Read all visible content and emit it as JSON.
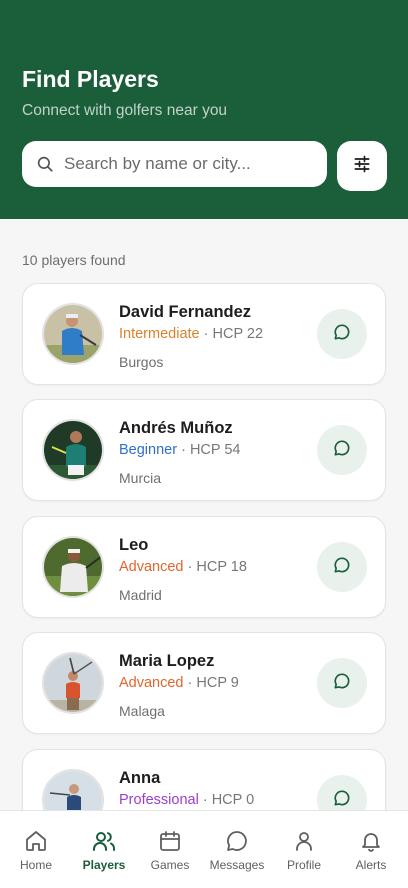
{
  "header": {
    "title": "Find Players",
    "subtitle": "Connect with golfers near you",
    "search_placeholder": "Search by name or city..."
  },
  "results": {
    "count_label": "10 players found"
  },
  "players": [
    {
      "name": "David Fernandez",
      "level": "Intermediate",
      "level_color": "#d9822b",
      "handicap": "HCP 22",
      "city": "Burgos"
    },
    {
      "name": "Andrés Muñoz",
      "level": "Beginner",
      "level_color": "#2f6fcf",
      "handicap": "HCP 54",
      "city": "Murcia"
    },
    {
      "name": "Leo",
      "level": "Advanced",
      "level_color": "#e0662a",
      "handicap": "HCP 18",
      "city": "Madrid"
    },
    {
      "name": "Maria Lopez",
      "level": "Advanced",
      "level_color": "#e0662a",
      "handicap": "HCP 9",
      "city": "Malaga"
    },
    {
      "name": "Anna",
      "level": "Professional",
      "level_color": "#9b3fd0",
      "handicap": "HCP 0",
      "city": ""
    }
  ],
  "separator": " · ",
  "tabs": [
    {
      "label": "Home",
      "icon": "home-icon"
    },
    {
      "label": "Players",
      "icon": "players-icon",
      "active": true
    },
    {
      "label": "Games",
      "icon": "calendar-icon"
    },
    {
      "label": "Messages",
      "icon": "message-icon"
    },
    {
      "label": "Profile",
      "icon": "profile-icon"
    },
    {
      "label": "Alerts",
      "icon": "bell-icon"
    }
  ],
  "colors": {
    "primary": "#1b5e3a",
    "message_button_bg": "#e9f1ec"
  }
}
